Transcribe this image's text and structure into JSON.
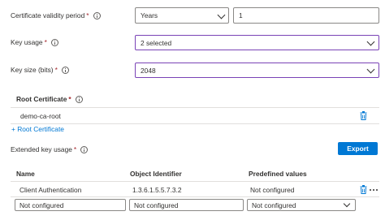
{
  "form": {
    "validity": {
      "label": "Certificate validity period",
      "required": "*",
      "unit_value": "Years",
      "number_value": "1"
    },
    "key_usage": {
      "label": "Key usage",
      "required": "*",
      "value": "2 selected"
    },
    "key_size": {
      "label": "Key size (bits)",
      "required": "*",
      "value": "2048"
    }
  },
  "root_certificate": {
    "heading": "Root Certificate",
    "required": "*",
    "item": "demo-ca-root",
    "add_link": "+ Root Certificate"
  },
  "eku": {
    "label": "Extended key usage",
    "required": "*",
    "export_label": "Export",
    "columns": [
      "Name",
      "Object Identifier",
      "Predefined values"
    ],
    "rows": [
      {
        "name": "Client Authentication",
        "oid": "1.3.6.1.5.5.7.3.2",
        "predefined": "Not configured"
      }
    ],
    "new_row": {
      "name_placeholder": "Not configured",
      "oid_placeholder": "Not configured",
      "predefined_value": "Not configured"
    }
  },
  "colors": {
    "accent": "#0078d4",
    "focus_border": "#7a43b6",
    "required": "#a4262c"
  },
  "icons": [
    "info-icon",
    "chevron-down-icon",
    "trash-icon",
    "more-icon"
  ]
}
